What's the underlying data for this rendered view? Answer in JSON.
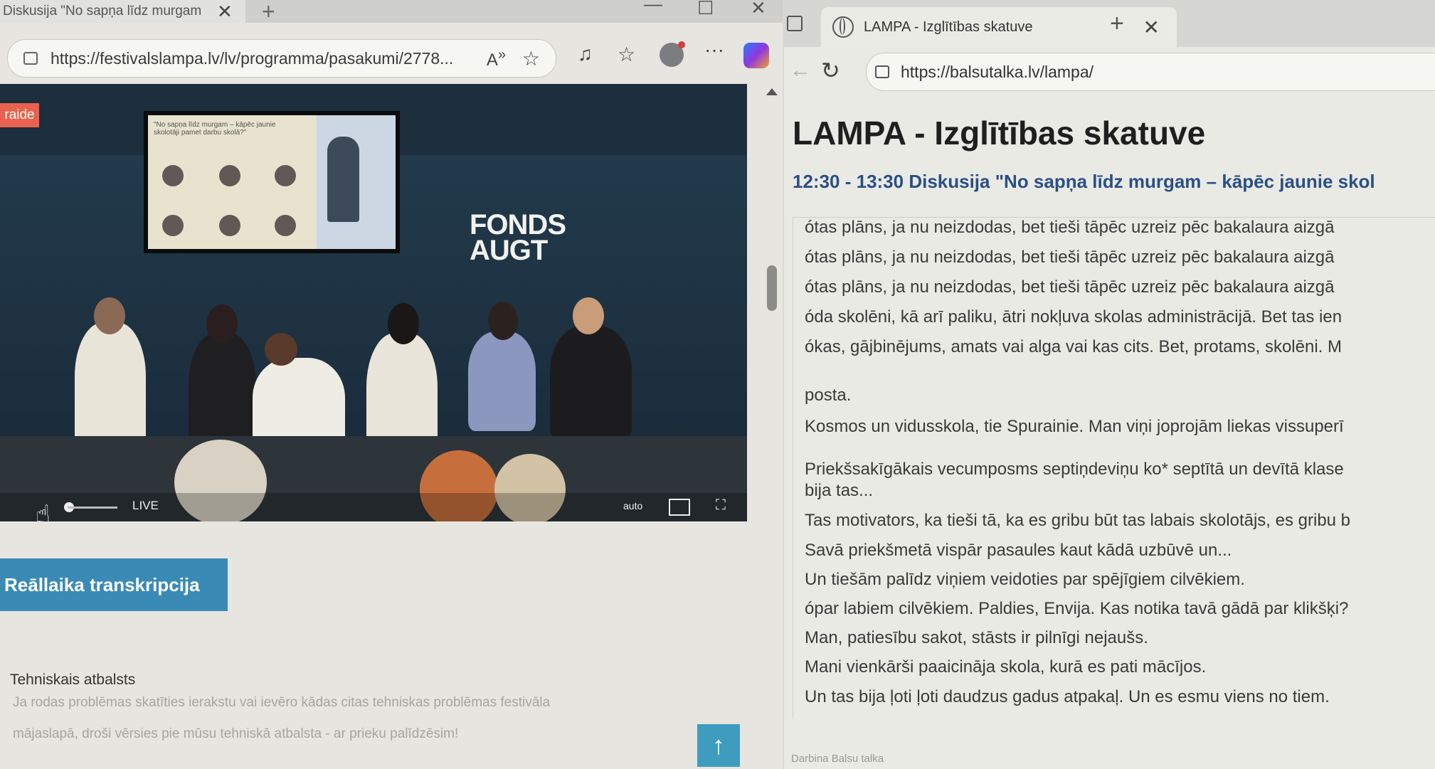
{
  "left": {
    "tab_title": "Diskusija \"No sapņa līdz murgam",
    "url": "https://festivalslampa.lv/lv/programma/pasakumi/2778...",
    "live_badge": "raide",
    "video": {
      "screen_title": "\"No sapņa līdz murgam – kāpēc jaunie skolotāji pamet darbu skolā?\"",
      "stage_logo_line1": "FONDS",
      "stage_logo_line2": "AUGT",
      "live_label": "LIVE",
      "quality_label": "auto"
    },
    "transcript_button": "Reāllaika transkripcija",
    "tech_heading": "Tehniskais atbalsts",
    "tech_text_1": "Ja rodas problēmas skatīties ierakstu vai ievēro kādas citas tehniskas problēmas festivāla",
    "tech_text_2": "mājaslapā, droši vērsies pie mūsu tehniskā atbalsta - ar prieku palīdzēsim!",
    "to_top": "↑"
  },
  "right": {
    "tab_title": "LAMPA - Izglītības skatuve",
    "url": "https://balsutalka.lv/lampa/",
    "page_title": "LAMPA - Izglītības skatuve",
    "session": "12:30 - 13:30 Diskusija \"No sapņa līdz murgam – kāpēc jaunie skol",
    "lines": [
      "ótas plāns, ja nu neizdodas, bet tieši tāpēc uzreiz pēc bakalaura aizgā",
      "ótas plāns, ja nu neizdodas, bet tieši tāpēc uzreiz pēc bakalaura aizgā",
      "ótas plāns, ja nu neizdodas, bet tieši tāpēc uzreiz pēc bakalaura aizgā",
      "óda skolēni, kā arī paliku, ātri nokļuva skolas administrācijā. Bet tas ien",
      "ókas, gājbinējums, amats vai alga vai kas cits. Bet, protams, skolēni. M",
      "posta.",
      "Kosmos un vidusskola, tie Spurainie. Man viņi joprojām liekas vissuperī",
      "Priekšsakīgākais vecumposms septiņdeviņu ko* septītā un devītā klase",
      "bija tas...",
      "Tas motivators, ka tieši tā, ka es gribu būt tas labais skolotājs, es gribu b",
      "Savā priekšmetā vispār pasaules kaut kādā uzbūvē un...",
      "Un tiešām palīdz viņiem veidoties par spējīgiem cilvēkiem.",
      "ópar labiem cilvēkiem. Paldies, Envija. Kas notika tavā gādā par klikšķi?",
      "Man, patiesību sakot, stāsts ir pilnīgi nejaušs.",
      "Mani vienkārši paaicināja skola, kurā es pati mācījos.",
      "Un tas bija ļoti ļoti daudzus gadus atpakaļ. Un es esmu viens no tiem."
    ],
    "footer": "Darbina Balsu talka"
  },
  "colors": {
    "accent_blue": "#3a8ab6",
    "session_blue": "#2b4f86",
    "live_red": "#e8624f"
  }
}
